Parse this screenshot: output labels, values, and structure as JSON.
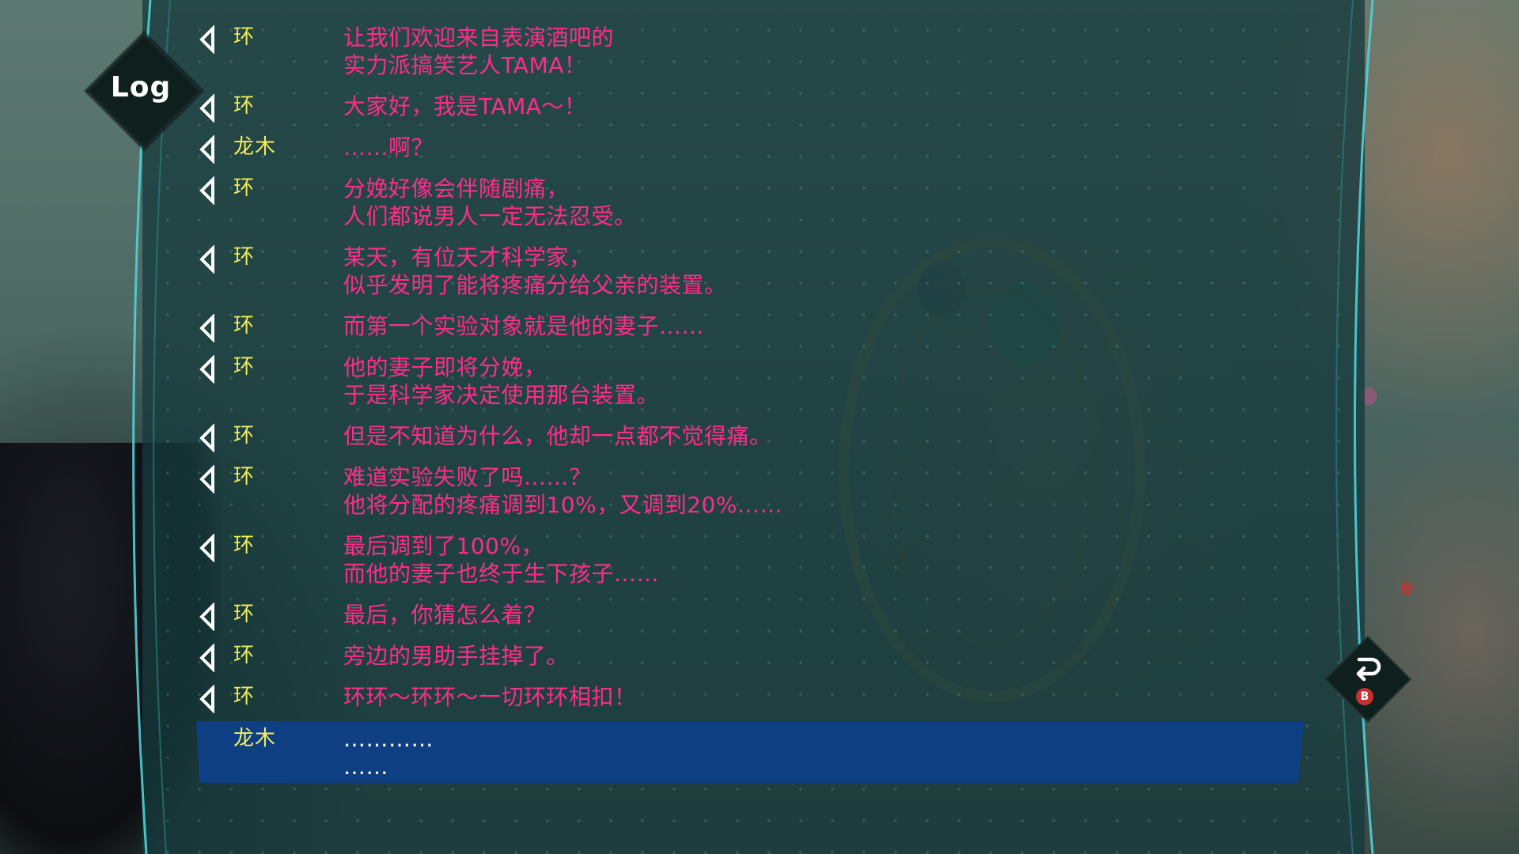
{
  "header": {
    "log_label": "Log"
  },
  "colors": {
    "speaker": "#f2f05a",
    "dialogue": "#ff2d8a",
    "selected_bar": "#0e3f82",
    "panel": "#163a3c"
  },
  "entries": [
    {
      "speaker": "环",
      "text": "让我们欢迎来自表演酒吧的\n实力派搞笑艺人TAMA！",
      "voice_icon": "speaker-triangle-icon"
    },
    {
      "speaker": "环",
      "text": "大家好，我是TAMA～！",
      "voice_icon": "speaker-triangle-icon"
    },
    {
      "speaker": "龙木",
      "text": "……啊？",
      "voice_icon": "speaker-triangle-icon"
    },
    {
      "speaker": "环",
      "text": "分娩好像会伴随剧痛，\n人们都说男人一定无法忍受。",
      "voice_icon": "speaker-triangle-icon"
    },
    {
      "speaker": "环",
      "text": "某天，有位天才科学家，\n似乎发明了能将疼痛分给父亲的装置。",
      "voice_icon": "speaker-triangle-icon"
    },
    {
      "speaker": "环",
      "text": "而第一个实验对象就是他的妻子……",
      "voice_icon": "speaker-triangle-icon"
    },
    {
      "speaker": "环",
      "text": "他的妻子即将分娩，\n于是科学家决定使用那台装置。",
      "voice_icon": "speaker-triangle-icon"
    },
    {
      "speaker": "环",
      "text": "但是不知道为什么，他却一点都不觉得痛。",
      "voice_icon": "speaker-triangle-icon"
    },
    {
      "speaker": "环",
      "text": "难道实验失败了吗……？\n他将分配的疼痛调到10%，又调到20%……",
      "voice_icon": "speaker-triangle-icon"
    },
    {
      "speaker": "环",
      "text": "最后调到了100%，\n而他的妻子也终于生下孩子……",
      "voice_icon": "speaker-triangle-icon"
    },
    {
      "speaker": "环",
      "text": "最后，你猜怎么着？",
      "voice_icon": "speaker-triangle-icon"
    },
    {
      "speaker": "环",
      "text": "旁边的男助手挂掉了。",
      "voice_icon": "speaker-triangle-icon"
    },
    {
      "speaker": "环",
      "text": "环环～环环～一切环环相扣！",
      "voice_icon": "speaker-triangle-icon"
    },
    {
      "speaker": "龙木",
      "text": "…………\n……",
      "selected": true
    }
  ],
  "footer": {
    "back_icon": "return-arrow-icon",
    "back_key": "B"
  }
}
